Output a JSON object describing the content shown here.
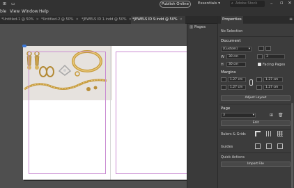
{
  "menu": [
    "ble",
    "View",
    "Window",
    "Help"
  ],
  "header": {
    "publish_label": "Publish Online",
    "workspace_label": "Essentials",
    "search_placeholder": "Adobe Stock"
  },
  "tabs": [
    {
      "label": "*Untitled-1 @ 50%",
      "active": false
    },
    {
      "label": "*Untitled-2 @ 50%",
      "active": false
    },
    {
      "label": "*JEWELS ID 1.indd @ 50%",
      "active": false
    },
    {
      "label": "*JEWELS ID 9.indd @ 50%",
      "active": true
    }
  ],
  "pages_panel": {
    "label": "Pages"
  },
  "properties": {
    "tab_label": "Properties",
    "selection": "No Selection",
    "document": {
      "title": "Document",
      "preset": "[Custom]",
      "width_label": "W",
      "width_value": "30 cm",
      "height_label": "H",
      "height_value": "30 cm",
      "pages_value": "3",
      "facing_pages_label": "Facing Pages",
      "facing_pages_checked": true
    },
    "margins": {
      "title": "Margins",
      "top": "1.27 cm",
      "bottom": "1.27 cm",
      "left": "1.27 cm",
      "right": "1.27 cm"
    },
    "adjust_layout_label": "Adjust Layout",
    "page": {
      "title": "Page",
      "value": "3",
      "edit_label": "Edit"
    },
    "rulers_grids_label": "Rulers & Grids",
    "guides_label": "Guides",
    "quick_actions_label": "Quick Actions",
    "import_file_label": "Import File"
  },
  "colors": {
    "app_dark": "#323232",
    "panel": "#3c3c3c",
    "pasteboard": "#4f4f4f",
    "margin_guide": "#c98bd2",
    "selection_blue": "#3c78d8"
  }
}
